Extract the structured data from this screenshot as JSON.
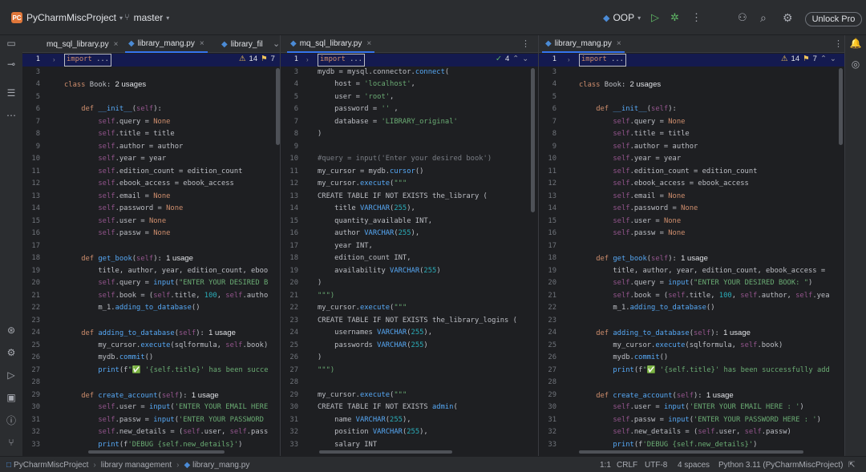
{
  "titlebar": {
    "project_badge": "PC",
    "project_name": "PyCharmMiscProject",
    "branch": "master",
    "run_config": "OOP",
    "unlock_label": "Unlock Pro"
  },
  "panels": [
    {
      "tabs": [
        {
          "label": "mq_sql_library.py",
          "active": false
        },
        {
          "label": "library_mang.py",
          "active": true
        },
        {
          "label": "library_fil",
          "active": false
        }
      ],
      "inspection": {
        "warnings": "14",
        "weak": "7"
      },
      "lines": [
        {
          "n": "1",
          "t": "import ..."
        },
        {
          "n": "3",
          "t": ""
        },
        {
          "n": "4",
          "t": "class Book:  2 usages"
        },
        {
          "n": "5",
          "t": ""
        },
        {
          "n": "6",
          "t": "    def __init__(self):"
        },
        {
          "n": "7",
          "t": "        self.query = None"
        },
        {
          "n": "8",
          "t": "        self.title = title"
        },
        {
          "n": "9",
          "t": "        self.author = author"
        },
        {
          "n": "10",
          "t": "        self.year = year"
        },
        {
          "n": "11",
          "t": "        self.edition_count = edition_count"
        },
        {
          "n": "12",
          "t": "        self.ebook_access = ebook_access"
        },
        {
          "n": "13",
          "t": "        self.email = None"
        },
        {
          "n": "14",
          "t": "        self.password = None"
        },
        {
          "n": "15",
          "t": "        self.user = None"
        },
        {
          "n": "16",
          "t": "        self.passw = None"
        },
        {
          "n": "17",
          "t": ""
        },
        {
          "n": "18",
          "t": "    def get_book(self):  1 usage"
        },
        {
          "n": "19",
          "t": "        title, author, year, edition_count, eboo"
        },
        {
          "n": "20",
          "t": "        self.query = input(\"ENTER YOUR DESIRED B"
        },
        {
          "n": "21",
          "t": "        self.book = (self.title, 100, self.autho"
        },
        {
          "n": "22",
          "t": "        m_1.adding_to_database()"
        },
        {
          "n": "23",
          "t": ""
        },
        {
          "n": "24",
          "t": "    def adding_to_database(self):  1 usage"
        },
        {
          "n": "25",
          "t": "        my_cursor.execute(sqlformula, self.book)"
        },
        {
          "n": "26",
          "t": "        mydb.commit()"
        },
        {
          "n": "27",
          "t": "        print(f\"✅ '{self.title}' has been succe"
        },
        {
          "n": "28",
          "t": ""
        },
        {
          "n": "29",
          "t": "    def create_account(self):  1 usage"
        },
        {
          "n": "30",
          "t": "        self.user = input('ENTER YOUR EMAIL HERE"
        },
        {
          "n": "31",
          "t": "        self.passw = input('ENTER YOUR PASSWORD"
        },
        {
          "n": "32",
          "t": "        self.new_details = (self.user, self.pass"
        },
        {
          "n": "33",
          "t": "        print(f'DEBUG {self.new_details}')"
        }
      ]
    },
    {
      "tabs": [
        {
          "label": "mq_sql_library.py",
          "active": true
        }
      ],
      "inspection": {
        "ok": "4"
      },
      "lines": [
        {
          "n": "1",
          "t": "import ..."
        },
        {
          "n": "3",
          "t": "mydb = mysql.connector.connect("
        },
        {
          "n": "4",
          "t": "    host = 'localhost',"
        },
        {
          "n": "5",
          "t": "    user = 'root',"
        },
        {
          "n": "6",
          "t": "    password = '' ,"
        },
        {
          "n": "7",
          "t": "    database = 'LIBRARY_original'"
        },
        {
          "n": "8",
          "t": ")"
        },
        {
          "n": "9",
          "t": ""
        },
        {
          "n": "10",
          "t": "#query = input('Enter your desired book')"
        },
        {
          "n": "11",
          "t": "my_cursor = mydb.cursor()"
        },
        {
          "n": "12",
          "t": "my_cursor.execute(\"\"\""
        },
        {
          "n": "13",
          "t": "CREATE TABLE IF NOT EXISTS the_library ("
        },
        {
          "n": "14",
          "t": "    title VARCHAR(255),"
        },
        {
          "n": "15",
          "t": "    quantity_available INT,"
        },
        {
          "n": "16",
          "t": "    author VARCHAR(255),"
        },
        {
          "n": "17",
          "t": "    year INT,"
        },
        {
          "n": "18",
          "t": "    edition_count INT,"
        },
        {
          "n": "19",
          "t": "    availability VARCHAR(255)"
        },
        {
          "n": "20",
          "t": ")"
        },
        {
          "n": "21",
          "t": "\"\"\")"
        },
        {
          "n": "22",
          "t": "my_cursor.execute(\"\"\""
        },
        {
          "n": "23",
          "t": "CREATE TABLE IF NOT EXISTS the_library_logins ("
        },
        {
          "n": "24",
          "t": "    usernames VARCHAR(255),"
        },
        {
          "n": "25",
          "t": "    passwords VARCHAR(255)"
        },
        {
          "n": "26",
          "t": ")"
        },
        {
          "n": "27",
          "t": "\"\"\")"
        },
        {
          "n": "28",
          "t": ""
        },
        {
          "n": "29",
          "t": "my_cursor.execute(\"\"\""
        },
        {
          "n": "30",
          "t": "CREATE TABLE IF NOT EXISTS admin("
        },
        {
          "n": "31",
          "t": "    name VARCHAR(255),"
        },
        {
          "n": "32",
          "t": "    position VARCHAR(255),"
        },
        {
          "n": "33",
          "t": "    salary INT"
        }
      ]
    },
    {
      "tabs": [
        {
          "label": "library_mang.py",
          "active": true
        }
      ],
      "inspection": {
        "warnings": "14",
        "weak": "7"
      },
      "lines": [
        {
          "n": "1",
          "t": "import ..."
        },
        {
          "n": "3",
          "t": ""
        },
        {
          "n": "4",
          "t": "class Book:  2 usages"
        },
        {
          "n": "5",
          "t": ""
        },
        {
          "n": "6",
          "t": "    def __init__(self):"
        },
        {
          "n": "7",
          "t": "        self.query = None"
        },
        {
          "n": "8",
          "t": "        self.title = title"
        },
        {
          "n": "9",
          "t": "        self.author = author"
        },
        {
          "n": "10",
          "t": "        self.year = year"
        },
        {
          "n": "11",
          "t": "        self.edition_count = edition_count"
        },
        {
          "n": "12",
          "t": "        self.ebook_access = ebook_access"
        },
        {
          "n": "13",
          "t": "        self.email = None"
        },
        {
          "n": "14",
          "t": "        self.password = None"
        },
        {
          "n": "15",
          "t": "        self.user = None"
        },
        {
          "n": "16",
          "t": "        self.passw = None"
        },
        {
          "n": "17",
          "t": ""
        },
        {
          "n": "18",
          "t": "    def get_book(self):  1 usage"
        },
        {
          "n": "19",
          "t": "        title, author, year, edition_count, ebook_access ="
        },
        {
          "n": "20",
          "t": "        self.query = input(\"ENTER YOUR DESIRED BOOK: \")"
        },
        {
          "n": "21",
          "t": "        self.book = (self.title, 100, self.author, self.yea"
        },
        {
          "n": "22",
          "t": "        m_1.adding_to_database()"
        },
        {
          "n": "23",
          "t": ""
        },
        {
          "n": "24",
          "t": "    def adding_to_database(self):  1 usage"
        },
        {
          "n": "25",
          "t": "        my_cursor.execute(sqlformula, self.book)"
        },
        {
          "n": "26",
          "t": "        mydb.commit()"
        },
        {
          "n": "27",
          "t": "        print(f\"✅ '{self.title}' has been successfully add"
        },
        {
          "n": "28",
          "t": ""
        },
        {
          "n": "29",
          "t": "    def create_account(self):  1 usage"
        },
        {
          "n": "30",
          "t": "        self.user = input('ENTER YOUR EMAIL HERE : ')"
        },
        {
          "n": "31",
          "t": "        self.passw = input('ENTER YOUR PASSWORD HERE : ')"
        },
        {
          "n": "32",
          "t": "        self.new_details = (self.user, self.passw)"
        },
        {
          "n": "33",
          "t": "        print(f'DEBUG {self.new_details}')"
        }
      ]
    }
  ],
  "statusbar": {
    "breadcrumb": [
      "PyCharmMiscProject",
      "library management",
      "library_mang.py"
    ],
    "position": "1:1",
    "line_sep": "CRLF",
    "encoding": "UTF-8",
    "indent": "4 spaces",
    "interpreter": "Python 3.11 (PyCharmMiscProject)"
  },
  "colors": {
    "bg": "#1e1f22",
    "chrome": "#2b2d30",
    "accent": "#3574f0",
    "keyword": "#cf8e6d",
    "string": "#6aab73",
    "self": "#94558d",
    "function": "#56a8f5",
    "number": "#2aacb8",
    "comment": "#7a7e85"
  }
}
